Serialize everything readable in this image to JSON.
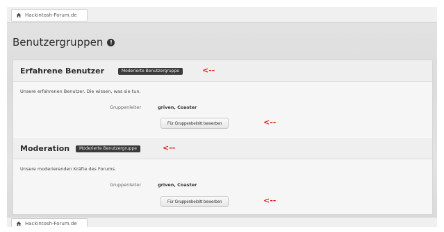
{
  "breadcrumb": {
    "label": "Hackintosh-Forum.de"
  },
  "page": {
    "title": "Benutzergruppen",
    "info_glyph": "!"
  },
  "groups": [
    {
      "name": "Erfahrene Benutzer",
      "badge": "Moderierte Benutzergruppe",
      "arrow": "<--",
      "description": "Unsere erfahrenen Benutzer. Die wissen, was sie tun.",
      "leader_label": "Gruppenleiter",
      "leaders": "griven, Coaster",
      "button_label": "Für Gruppenbeitritt bewerben",
      "button_arrow": "<--"
    },
    {
      "name": "Moderation",
      "badge": "Moderierte Benutzergruppe",
      "arrow": "<--",
      "description": "Unsere moderierenden Kräfte des Forums.",
      "leader_label": "Gruppenleiter",
      "leaders": "griven, Coaster",
      "button_label": "Für Gruppenbeitritt bewerben",
      "button_arrow": "<--"
    }
  ],
  "footer_breadcrumb": {
    "label": "Hackintosh-Forum.de"
  },
  "colors": {
    "annotation": "#e61c1c",
    "badge_bg": "#3b3b3b"
  },
  "icons": {
    "home": "home-icon",
    "info": "info-icon"
  }
}
